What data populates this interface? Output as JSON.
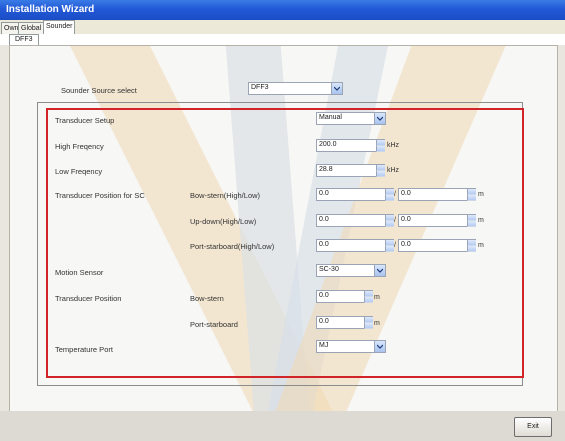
{
  "window": {
    "title": "Installation Wizard"
  },
  "tabs": [
    {
      "label": "Own",
      "active": false
    },
    {
      "label": "Global",
      "active": false
    },
    {
      "label": "Sounder",
      "active": true
    }
  ],
  "subtabs": [
    {
      "label": "DFF3",
      "active": true
    }
  ],
  "source": {
    "label": "Sounder Source select",
    "value": "DFF3"
  },
  "form": {
    "transducer_setup": {
      "label": "Transducer Setup",
      "value": "Manual"
    },
    "high_frequency": {
      "label": "High Freqency",
      "value": "200.0",
      "unit": "kHz"
    },
    "low_frequency": {
      "label": "Low Freqency",
      "value": "28.8",
      "unit": "kHz"
    },
    "position_sc": {
      "label": "Transducer Position for SC",
      "rows": [
        {
          "label": "Bow-stern(High/Low)",
          "high": "0.0",
          "low": "0.0",
          "unit": "m"
        },
        {
          "label": "Up-down(High/Low)",
          "high": "0.0",
          "low": "0.0",
          "unit": "m"
        },
        {
          "label": "Port-starboard(High/Low)",
          "high": "0.0",
          "low": "0.0",
          "unit": "m"
        }
      ],
      "separator": "/"
    },
    "motion_sensor": {
      "label": "Motion Sensor",
      "value": "SC-30"
    },
    "transducer_position": {
      "label": "Transducer Position",
      "rows": [
        {
          "label": "Bow-stern",
          "value": "0.0",
          "unit": "m"
        },
        {
          "label": "Port-starboard",
          "value": "0.0",
          "unit": "m"
        }
      ]
    },
    "temperature_port": {
      "label": "Temperature Port",
      "value": "MJ"
    }
  },
  "footer": {
    "exit_label": "Exit"
  },
  "colors": {
    "highlight_border": "#d12428",
    "title_bar": "#2259d6"
  }
}
